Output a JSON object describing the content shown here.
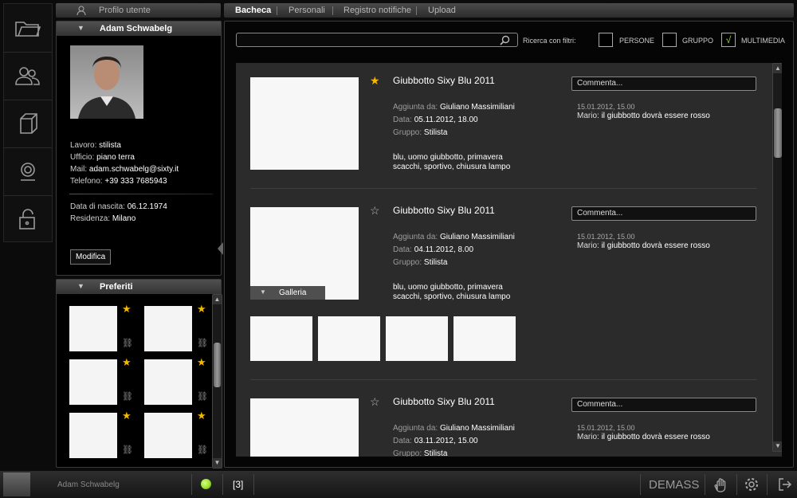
{
  "profile_tab": {
    "label": "Profilo utente"
  },
  "tabs": [
    {
      "label": "Bacheca"
    },
    {
      "label": "Personali"
    },
    {
      "label": "Registro notifiche"
    },
    {
      "label": "Upload"
    }
  ],
  "rail_icons": [
    "folder-icon",
    "users-icon",
    "cube-icon",
    "webcam-icon",
    "unlock-icon"
  ],
  "user": {
    "name": "Adam Schwabelg",
    "lavoro_label": "Lavoro:",
    "lavoro": "stilista",
    "ufficio_label": "Ufficio:",
    "ufficio": "piano terra",
    "mail_label": "Mail:",
    "mail": "adam.schwabelg@sixty.it",
    "telefono_label": "Telefono:",
    "telefono": "+39 333 7685943",
    "nascita_label": "Data di nascita:",
    "nascita": "06.12.1974",
    "residenza_label": "Residenza:",
    "residenza": "Milano",
    "edit_button": "Modifica"
  },
  "favorites": {
    "title": "Preferiti"
  },
  "search": {
    "placeholder": "",
    "filter_label": "Ricerca con filtri:"
  },
  "filters": [
    {
      "label": "PERSONE",
      "checked": false
    },
    {
      "label": "GRUPPO",
      "checked": false
    },
    {
      "label": "MULTIMEDIA",
      "checked": true,
      "mark": "√"
    }
  ],
  "posts": [
    {
      "title": "Giubbotto Sixy Blu 2011",
      "starred": true,
      "added_label": "Aggiunta da:",
      "added_by": "Giuliano Massimiliani",
      "date_label": "Data:",
      "date": "05.11.2012, 18.00",
      "group_label": "Gruppo:",
      "group": "Stilista",
      "tags_1": "blu, uomo giubbotto, primavera",
      "tags_2": "scacchi, sportivo, chiusura lampo",
      "comment_placeholder": "Commenta...",
      "comment_date": "15.01.2012, 15.00",
      "comment_author": "Mario:",
      "comment_text": "il giubbotto dovrà essere rosso"
    },
    {
      "title": "Giubbotto Sixy Blu 2011",
      "starred": false,
      "added_label": "Aggiunta da:",
      "added_by": "Giuliano Massimiliani",
      "date_label": "Data:",
      "date": "04.11.2012, 8.00",
      "group_label": "Gruppo:",
      "group": "Stilista",
      "tags_1": "blu, uomo giubbotto, primavera",
      "tags_2": "scacchi, sportivo, chiusura lampo",
      "gallery_label": "Galleria",
      "comment_placeholder": "Commenta...",
      "comment_date": "15.01.2012, 15.00",
      "comment_author": "Mario:",
      "comment_text": "il giubbotto dovrà essere rosso"
    },
    {
      "title": "Giubbotto Sixy Blu 2011",
      "starred": false,
      "added_label": "Aggiunta da:",
      "added_by": "Giuliano Massimiliani",
      "date_label": "Data:",
      "date": "03.11.2012, 15.00",
      "group_label": "Gruppo:",
      "group": "Stilista",
      "comment_placeholder": "Commenta...",
      "comment_date": "15.01.2012, 15.00",
      "comment_author": "Mario:",
      "comment_text": "il giubbotto dovrà essere rosso"
    }
  ],
  "bottom": {
    "user_name": "Adam Schwabelg",
    "status_color": "#9be22c",
    "notifications": "[3]",
    "brand": "DEMASS"
  },
  "colors": {
    "star_gold": "#f5b800",
    "accent_green": "#9be22c"
  }
}
